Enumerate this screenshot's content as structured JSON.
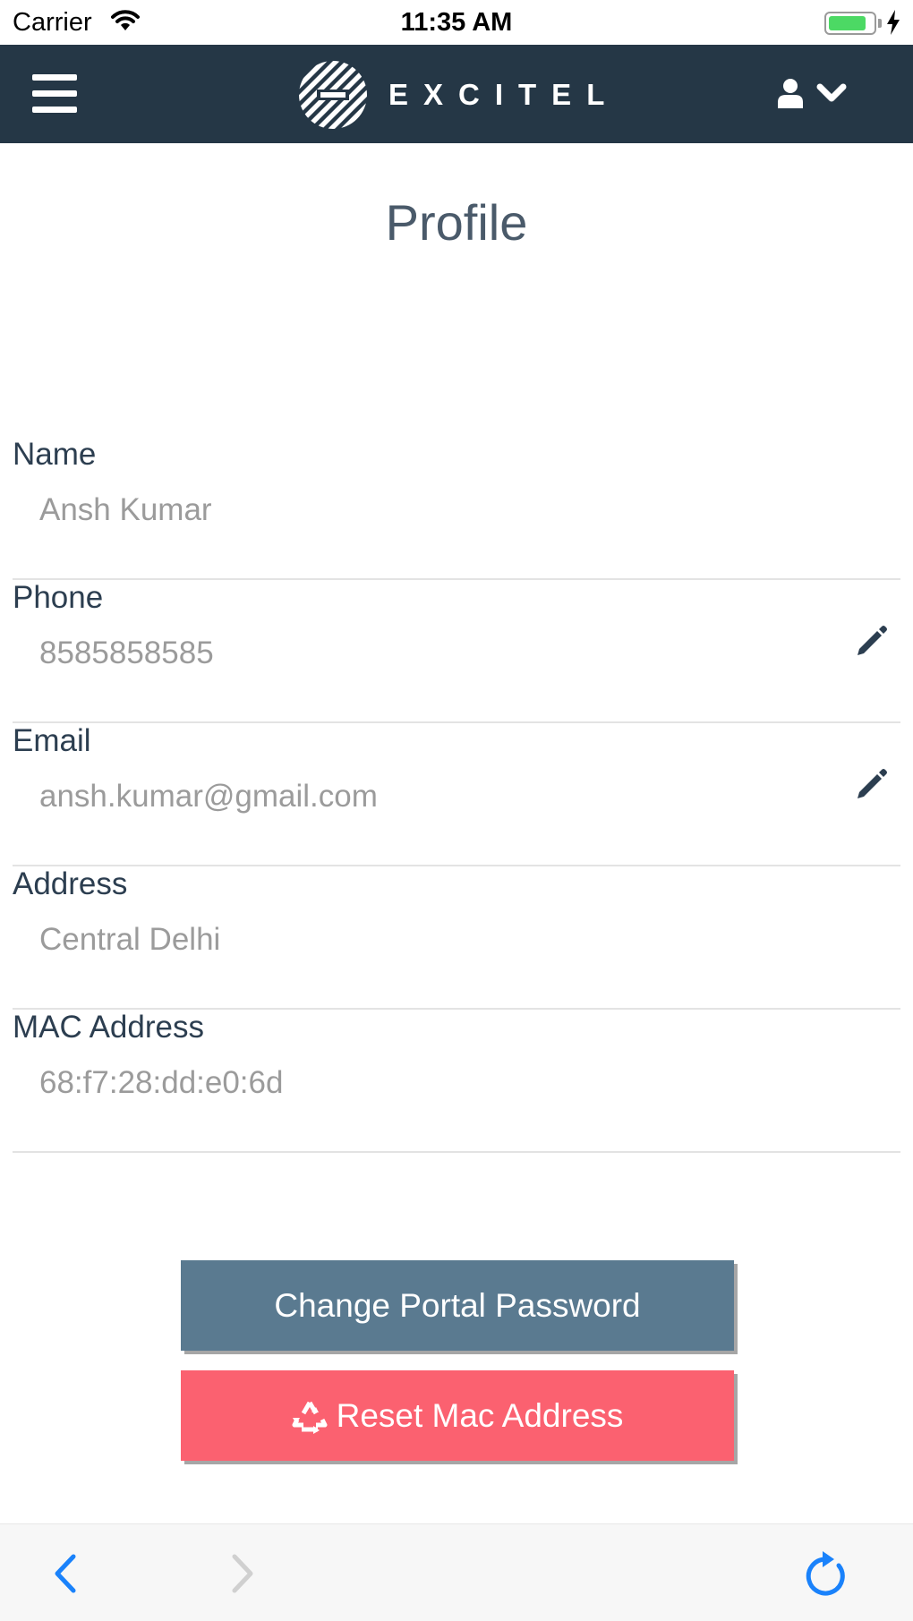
{
  "status_bar": {
    "carrier": "Carrier",
    "time": "11:35 AM",
    "battery_level": 0.85,
    "charging": true
  },
  "header": {
    "brand": "EXCITEL",
    "menu_icon": "hamburger-icon",
    "user_icon": "user-icon",
    "dropdown_icon": "chevron-down-icon"
  },
  "page": {
    "title": "Profile"
  },
  "fields": [
    {
      "label": "Name",
      "value": "Ansh Kumar",
      "editable": false
    },
    {
      "label": "Phone",
      "value": "8585858585",
      "editable": true
    },
    {
      "label": "Email",
      "value": "ansh.kumar@gmail.com",
      "editable": true
    },
    {
      "label": "Address",
      "value": "Central Delhi",
      "editable": false
    },
    {
      "label": "MAC Address",
      "value": "68:f7:28:dd:e0:6d",
      "editable": false
    }
  ],
  "buttons": {
    "change_password": "Change Portal Password",
    "reset_mac": "Reset Mac Address",
    "reset_icon": "recycle-icon"
  },
  "toolbar": {
    "back_icon": "back-arrow-icon",
    "forward_icon": "forward-arrow-icon",
    "reload_icon": "reload-icon"
  },
  "colors": {
    "header_bg": "#253746",
    "primary_button": "#5a7a90",
    "danger_button": "#fb6170",
    "ios_blue": "#1a82fb",
    "label": "#2c3e50",
    "value": "#9b9b9b"
  }
}
